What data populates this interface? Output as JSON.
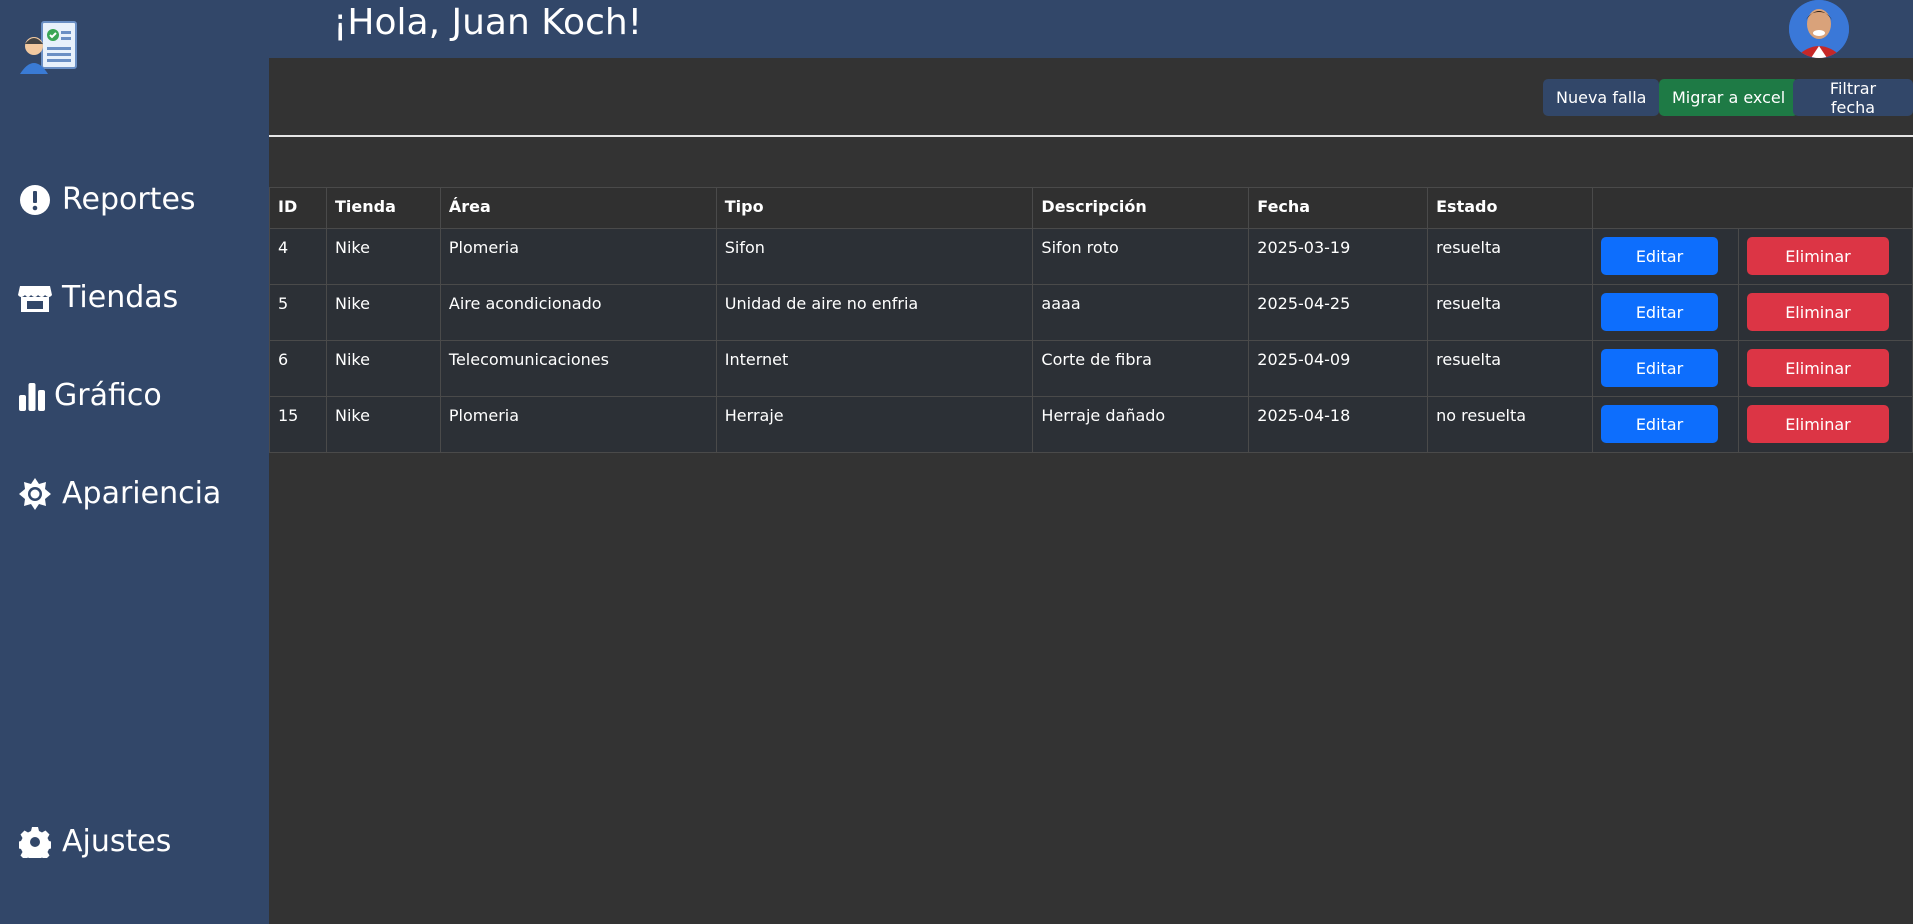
{
  "header": {
    "greeting": "¡Hola, Juan Koch!"
  },
  "sidebar": {
    "items": [
      {
        "label": "Reportes",
        "icon": "exclamation-circle-icon"
      },
      {
        "label": "Tiendas",
        "icon": "store-icon"
      },
      {
        "label": "Gráfico",
        "icon": "bar-chart-icon"
      },
      {
        "label": "Apariencia",
        "icon": "sun-gear-icon"
      }
    ],
    "settings": {
      "label": "Ajustes",
      "icon": "gear-icon"
    }
  },
  "toolbar": {
    "new_label": "Nueva falla",
    "excel_label": "Migrar a excel",
    "filter_label": "Filtrar fecha"
  },
  "table": {
    "columns": [
      "ID",
      "Tienda",
      "Área",
      "Tipo",
      "Descripción",
      "Fecha",
      "Estado",
      ""
    ],
    "edit_label": "Editar",
    "delete_label": "Eliminar",
    "rows": [
      {
        "id": "4",
        "tienda": "Nike",
        "area": "Plomeria",
        "tipo": "Sifon",
        "descripcion": "Sifon roto",
        "fecha": "2025-03-19",
        "estado": "resuelta"
      },
      {
        "id": "5",
        "tienda": "Nike",
        "area": "Aire acondicionado",
        "tipo": "Unidad de aire no enfria",
        "descripcion": "aaaa",
        "fecha": "2025-04-25",
        "estado": "resuelta"
      },
      {
        "id": "6",
        "tienda": "Nike",
        "area": "Telecomunicaciones",
        "tipo": "Internet",
        "descripcion": "Corte de fibra",
        "fecha": "2025-04-09",
        "estado": "resuelta"
      },
      {
        "id": "15",
        "tienda": "Nike",
        "area": "Plomeria",
        "tipo": "Herraje",
        "descripcion": "Herraje dañado",
        "fecha": "2025-04-18",
        "estado": "no resuelta"
      }
    ]
  },
  "colors": {
    "sidebar": "#324769",
    "background": "#333333",
    "edit": "#0d6efd",
    "delete": "#dc3545",
    "excel": "#1e7a45",
    "primary_dark": "#324769"
  }
}
